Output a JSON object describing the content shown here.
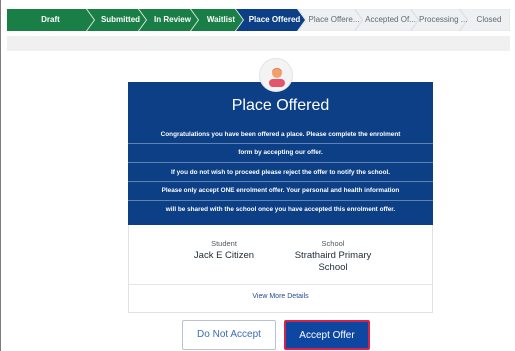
{
  "stepper": {
    "steps": [
      {
        "label": "Draft",
        "state": "done"
      },
      {
        "label": "Submitted",
        "state": "done"
      },
      {
        "label": "In Review",
        "state": "done"
      },
      {
        "label": "Waitlist",
        "state": "done"
      },
      {
        "label": "Place Offered",
        "state": "current"
      },
      {
        "label": "Place Offere...",
        "state": "future"
      },
      {
        "label": "Accepted Of...",
        "state": "future"
      },
      {
        "label": "Processing ...",
        "state": "future"
      },
      {
        "label": "Closed",
        "state": "future"
      }
    ]
  },
  "card": {
    "avatar_icon": "person-avatar-icon",
    "title": "Place Offered",
    "message_lines": [
      "Congratulations you have been offered a place. Please complete the enrolment",
      "form by accepting our offer.",
      "If you do not wish to proceed please reject the offer to notify the school.",
      "Please only accept ONE enrolment offer. Your personal and health information",
      "will be shared with the school once you have accepted this enrolment offer."
    ],
    "student_label": "Student",
    "student_value": "Jack E Citizen",
    "school_label": "School",
    "school_value_line1": "Strathaird Primary",
    "school_value_line2": "School",
    "view_more": "View More Details"
  },
  "actions": {
    "decline_label": "Do Not Accept",
    "accept_label": "Accept Offer"
  },
  "colors": {
    "done": "#1a7f46",
    "current": "#0c3f86",
    "future": "#e9ecee",
    "card": "#0c3f86",
    "accept_border": "#d6234b"
  }
}
